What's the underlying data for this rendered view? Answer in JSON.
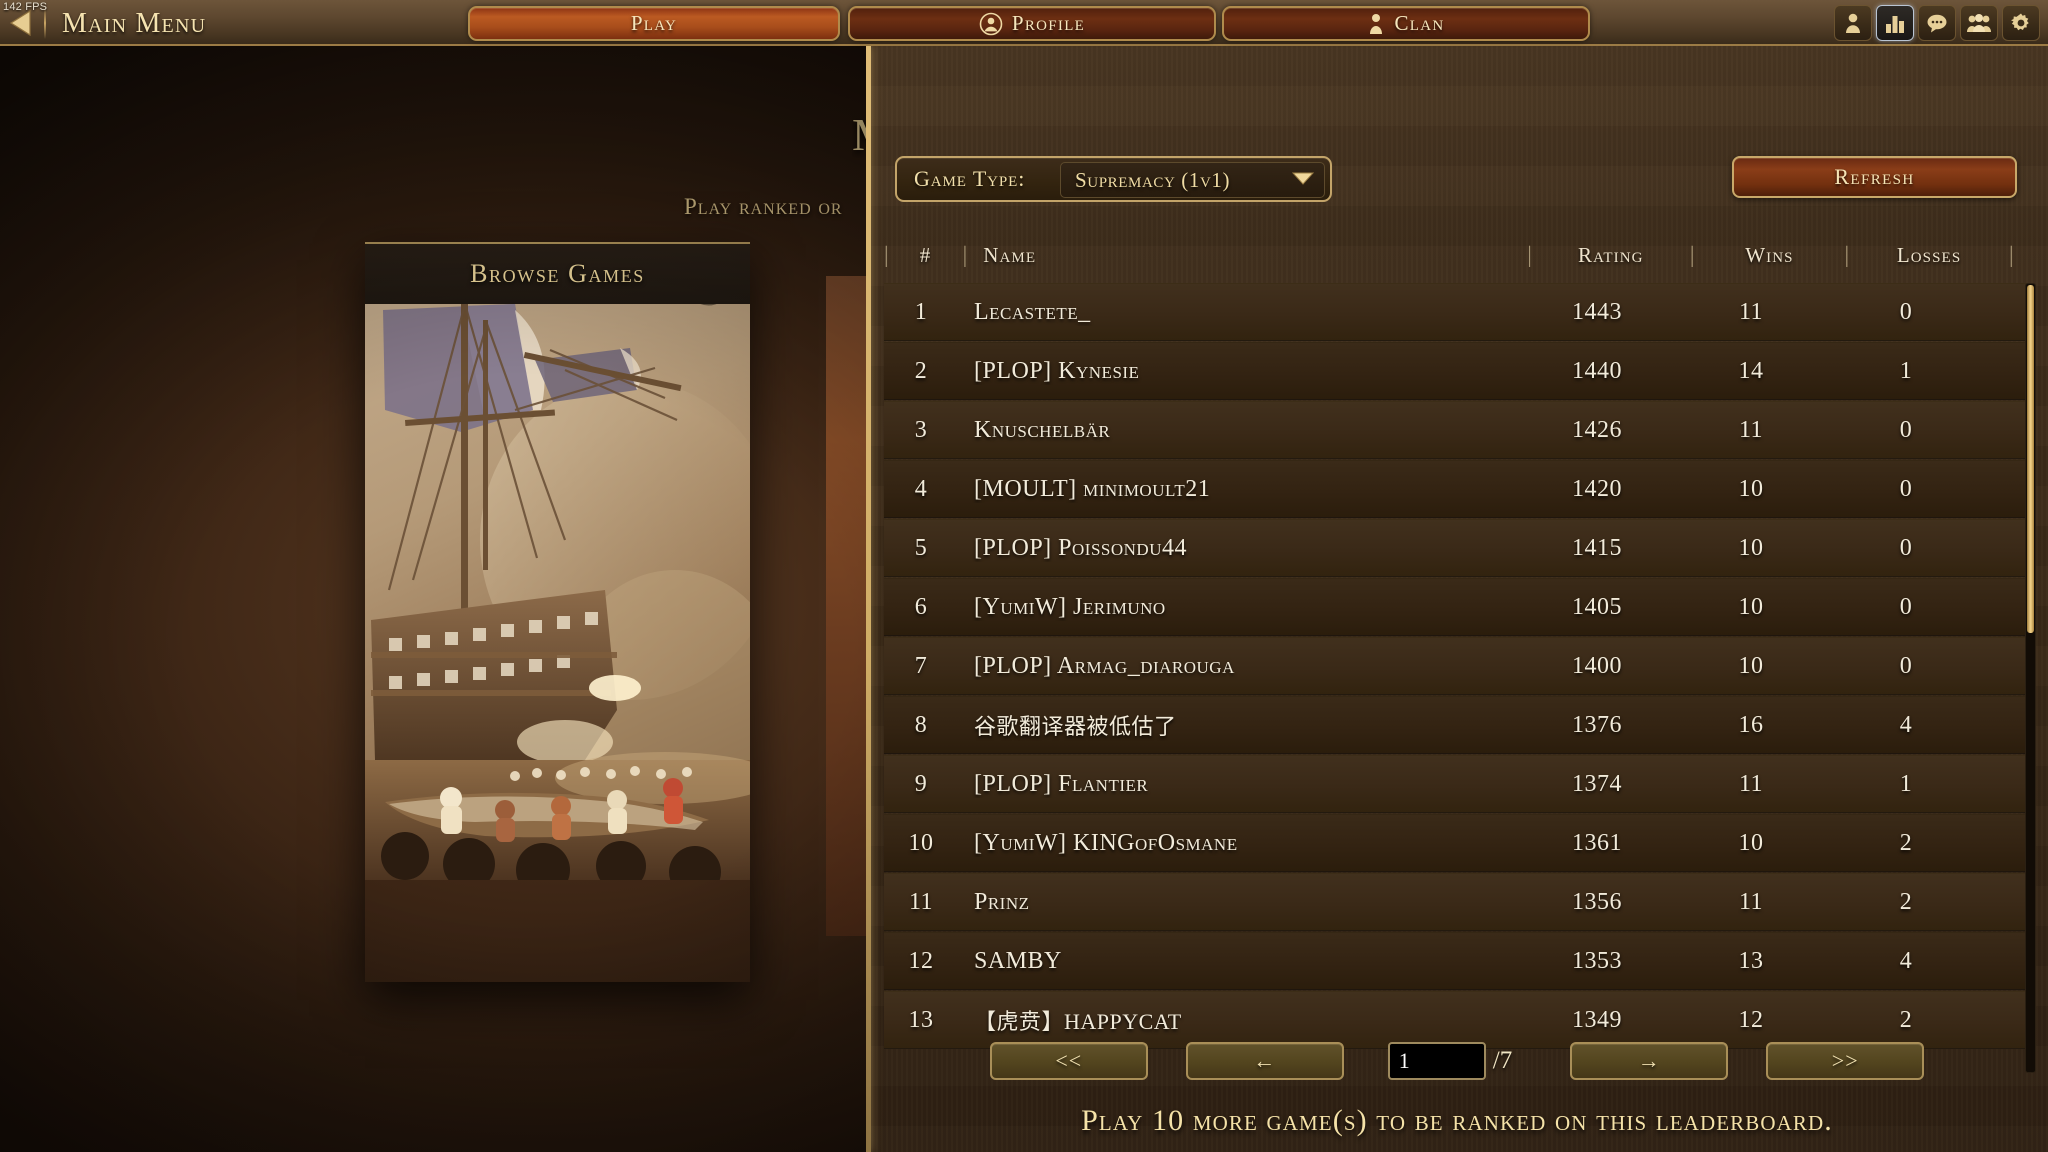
{
  "topbar": {
    "fps": "142 FPS",
    "back_icon": "back-triangle-icon",
    "title": "Main Menu",
    "tabs": [
      {
        "label": "Play",
        "icon": "none",
        "active": true
      },
      {
        "label": "Profile",
        "icon": "profile-person-icon",
        "active": false
      },
      {
        "label": "Clan",
        "icon": "clan-person-icon",
        "active": false
      }
    ],
    "icons": [
      {
        "name": "person-icon",
        "active": false
      },
      {
        "name": "stats-bar-chart-icon",
        "active": true
      },
      {
        "name": "chat-bubble-icon",
        "active": false
      },
      {
        "name": "group-people-icon",
        "active": false
      },
      {
        "name": "gear-settings-icon",
        "active": false
      }
    ]
  },
  "background": {
    "title_fragment": "M",
    "subtitle": "Play ranked or",
    "card_caption": "Browse Games"
  },
  "panel": {
    "gametype_label": "Game Type:",
    "gametype_value": "Supremacy (1v1)",
    "dropdown_icon": "chevron-down-icon",
    "refresh_label": "Refresh",
    "columns": [
      "#",
      "Name",
      "Rating",
      "Wins",
      "Losses"
    ],
    "pipe": "|",
    "rows": [
      {
        "rank": "1",
        "name": "Lecastete_",
        "rating": "1443",
        "wins": "11",
        "losses": "0"
      },
      {
        "rank": "2",
        "name": "[PLOP] Kynesie",
        "rating": "1440",
        "wins": "14",
        "losses": "1"
      },
      {
        "rank": "3",
        "name": "Knuschelbär",
        "rating": "1426",
        "wins": "11",
        "losses": "0"
      },
      {
        "rank": "4",
        "name": "[MOULT] minimoult21",
        "rating": "1420",
        "wins": "10",
        "losses": "0"
      },
      {
        "rank": "5",
        "name": "[PLOP] Poissondu44",
        "rating": "1415",
        "wins": "10",
        "losses": "0"
      },
      {
        "rank": "6",
        "name": "[YumiW] Jerimuno",
        "rating": "1405",
        "wins": "10",
        "losses": "0"
      },
      {
        "rank": "7",
        "name": "[PLOP] Armag_diarouga",
        "rating": "1400",
        "wins": "10",
        "losses": "0"
      },
      {
        "rank": "8",
        "name": "谷歌翻译器被低估了",
        "rating": "1376",
        "wins": "16",
        "losses": "4",
        "cjk": true
      },
      {
        "rank": "9",
        "name": "[PLOP] Flantier",
        "rating": "1374",
        "wins": "11",
        "losses": "1"
      },
      {
        "rank": "10",
        "name": "[YumiW] KINGofOsmane",
        "rating": "1361",
        "wins": "10",
        "losses": "2"
      },
      {
        "rank": "11",
        "name": "Prinz",
        "rating": "1356",
        "wins": "11",
        "losses": "2"
      },
      {
        "rank": "12",
        "name": "SAMBY",
        "rating": "1353",
        "wins": "13",
        "losses": "4"
      },
      {
        "rank": "13",
        "name": "【虎贲】HAPPYCAT",
        "rating": "1349",
        "wins": "12",
        "losses": "2",
        "cjk": true
      }
    ],
    "pagination": {
      "first": "<<",
      "prev": "←",
      "page_value": "1",
      "total": "/7",
      "next": "→",
      "last": ">>"
    },
    "status_message": "Play 10 more game(s) to be ranked on this leaderboard."
  },
  "colors": {
    "gold": "#f2e0ab",
    "panel_bg": "#3e2d1c",
    "row_bg": "#41301d",
    "play_tab": "#bb5a22",
    "refresh_btn": "#8a3d18"
  }
}
